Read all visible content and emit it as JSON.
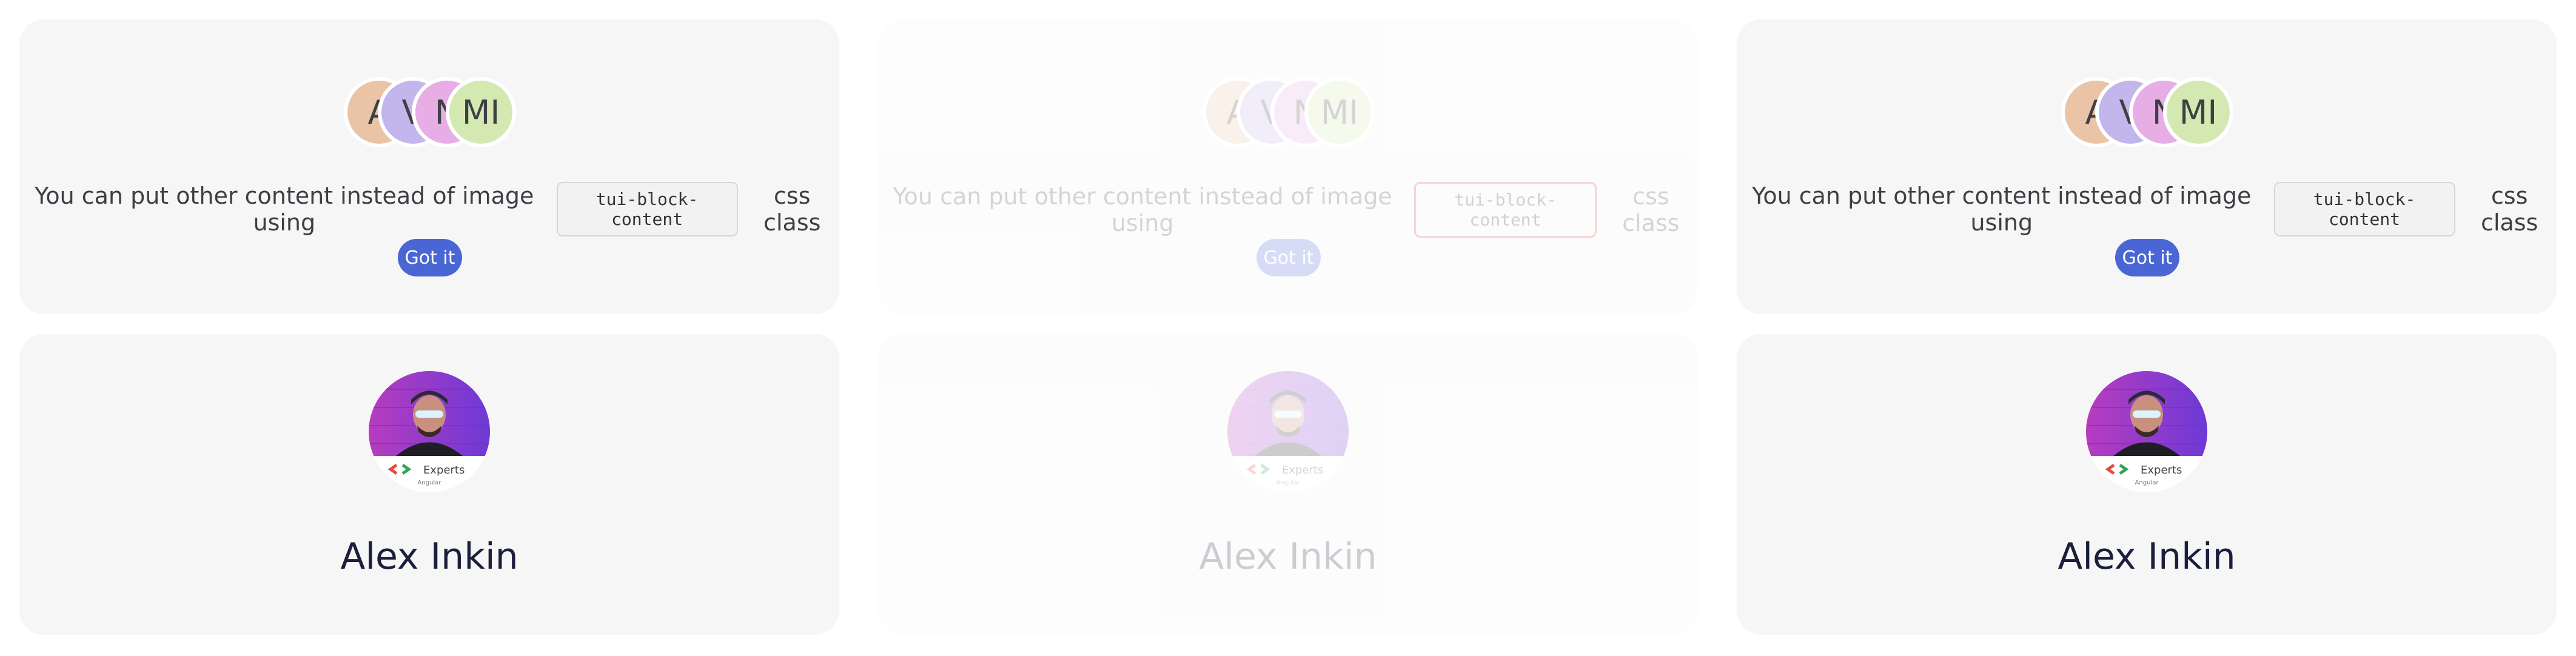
{
  "columns": [
    {
      "avatars": [
        {
          "initial": "A",
          "color": "#e9c4a6"
        },
        {
          "initial": "V",
          "color": "#c2b6ec"
        },
        {
          "initial": "N",
          "color": "#e7aee6"
        },
        {
          "initial": "MI",
          "color": "#d4e9b1"
        }
      ],
      "message_before": "You can put other content instead of image using",
      "code_text": "tui-block-content",
      "message_after": "css class",
      "button_label": "Got it",
      "profile": {
        "badge_title": "Experts",
        "badge_subtitle": "Angular",
        "name": "Alex Inkin"
      }
    },
    {
      "avatars": [
        {
          "initial": "A",
          "color": "#e9c4a6"
        },
        {
          "initial": "V",
          "color": "#c2b6ec"
        },
        {
          "initial": "N",
          "color": "#e7aee6"
        },
        {
          "initial": "MI",
          "color": "#d4e9b1"
        }
      ],
      "message_before": "You can put other content instead of image using",
      "code_text": "tui-block-content",
      "message_after": "css class",
      "button_label": "Got it",
      "profile": {
        "badge_title": "Experts",
        "badge_subtitle": "Angular",
        "name": "Alex Inkin"
      }
    },
    {
      "avatars": [
        {
          "initial": "A",
          "color": "#e9c4a6"
        },
        {
          "initial": "V",
          "color": "#c2b6ec"
        },
        {
          "initial": "N",
          "color": "#e7aee6"
        },
        {
          "initial": "MI",
          "color": "#d4e9b1"
        }
      ],
      "message_before": "You can put other content instead of image using",
      "code_text": "tui-block-content",
      "message_after": "css class",
      "button_label": "Got it",
      "profile": {
        "badge_title": "Experts",
        "badge_subtitle": "Angular",
        "name": "Alex Inkin"
      }
    }
  ],
  "colors": {
    "card_bg": "#f6f6f6",
    "button": "#4a66d4",
    "focus_outline": "#e04040",
    "name_text": "#1b1f3b"
  }
}
